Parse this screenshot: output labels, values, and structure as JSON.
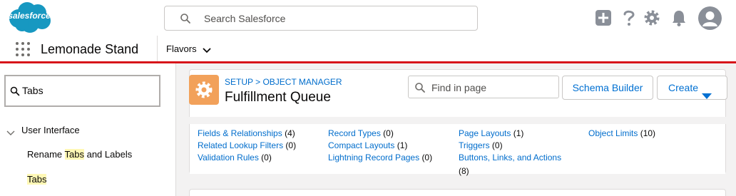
{
  "brand": {
    "logo_text": "salesforce",
    "logo_color": "#1798c1"
  },
  "search": {
    "placeholder": "Search Salesforce"
  },
  "header_icons": [
    "add-icon",
    "help-icon",
    "setup-gear-icon",
    "notification-bell-icon",
    "user-avatar"
  ],
  "app_nav": {
    "app_name": "Lemonade Stand",
    "items": [
      {
        "label": "Flavors"
      }
    ],
    "accent": "#d7141a"
  },
  "sidebar": {
    "quick_find_value": "Tabs",
    "group": "User Interface",
    "items": [
      {
        "before": "Rename ",
        "match": "Tabs",
        "after": " and Labels"
      },
      {
        "before": "",
        "match": "Tabs",
        "after": ""
      }
    ]
  },
  "object_header": {
    "breadcrumb": "SETUP > OBJECT MANAGER",
    "title": "Fulfillment Queue",
    "find_placeholder": "Find in page",
    "buttons": {
      "schema_builder": "Schema Builder",
      "create": "Create"
    }
  },
  "quick_links": [
    {
      "label": "Fields & Relationships",
      "count": "(4)"
    },
    {
      "label": "Related Lookup Filters",
      "count": "(0)"
    },
    {
      "label": "Validation Rules",
      "count": "(0)"
    },
    {
      "label": "Record Types",
      "count": "(0)"
    },
    {
      "label": "Compact Layouts",
      "count": "(1)"
    },
    {
      "label": "Lightning Record Pages",
      "count": "(0)"
    },
    {
      "label": "Page Layouts",
      "count": "(1)"
    },
    {
      "label": "Triggers",
      "count": "(0)"
    },
    {
      "label": "Buttons, Links, and Actions",
      "count": "(8)"
    },
    {
      "label": "Object Limits",
      "count": "(10)"
    }
  ]
}
